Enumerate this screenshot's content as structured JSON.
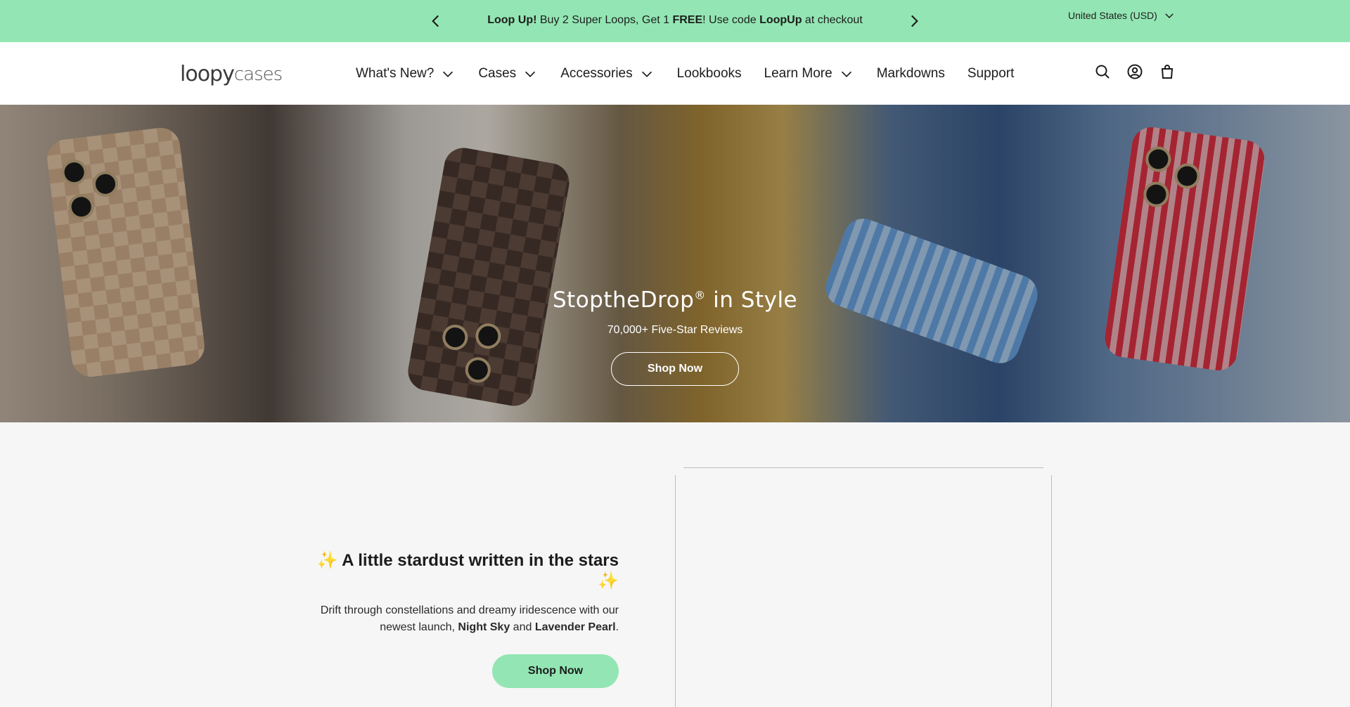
{
  "announcement": {
    "prev_icon": "chevron-left-icon",
    "next_icon": "chevron-right-icon",
    "lead": "Loop Up!",
    "text1": " Buy 2 Super Loops, Get 1 ",
    "free": "FREE",
    "text2": "! Use code ",
    "code": "LoopUp",
    "text3": " at checkout",
    "country": "United States (USD)",
    "background": "#93e6b3"
  },
  "header": {
    "logo_part1": "loopy",
    "logo_part2": "cases",
    "nav": [
      {
        "label": "What's New?",
        "has_dropdown": true
      },
      {
        "label": "Cases",
        "has_dropdown": true
      },
      {
        "label": "Accessories",
        "has_dropdown": true
      },
      {
        "label": "Lookbooks",
        "has_dropdown": false
      },
      {
        "label": "Learn More",
        "has_dropdown": true
      },
      {
        "label": "Markdowns",
        "has_dropdown": false
      },
      {
        "label": "Support",
        "has_dropdown": false
      }
    ],
    "icons": [
      "search-icon",
      "account-icon",
      "cart-icon"
    ]
  },
  "hero": {
    "title": "StoptheDrop",
    "title_mark": "®",
    "title_suffix": " in Style",
    "subtitle": "70,000+ Five-Star Reviews",
    "button": "Shop Now"
  },
  "feature": {
    "title": "✨ A little stardust written in the stars ✨",
    "desc1": "Drift through constellations and dreamy iridescence with our newest launch, ",
    "highlight1": "Night Sky",
    "desc2": " and ",
    "highlight2": "Lavender Pearl",
    "desc3": ".",
    "button": "Shop Now",
    "accent": "#93e6b3"
  }
}
